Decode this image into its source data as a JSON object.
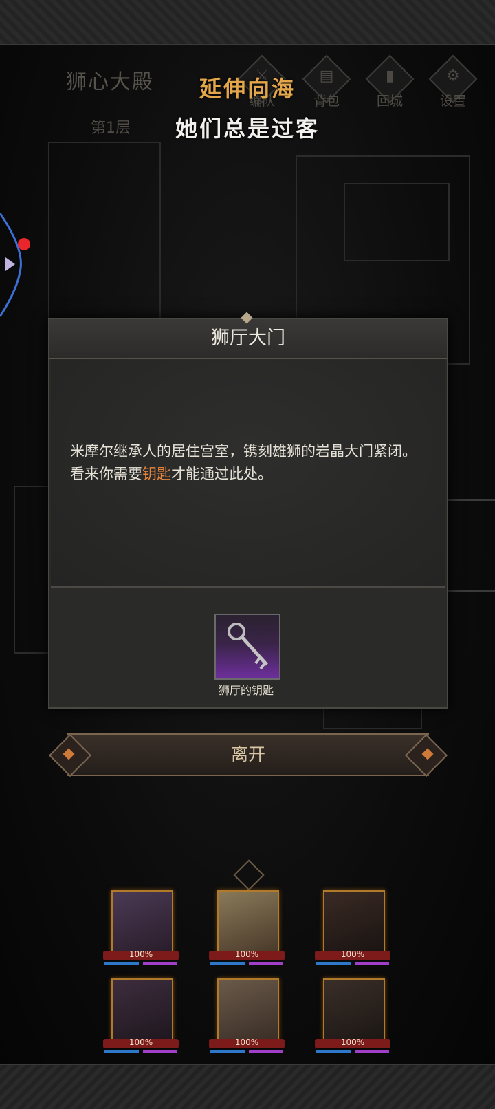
{
  "location": {
    "name": "狮心大殿",
    "floor": "第1层"
  },
  "nav": [
    {
      "label": "编队",
      "icon": "team-icon"
    },
    {
      "label": "背包",
      "icon": "backpack-icon"
    },
    {
      "label": "回城",
      "icon": "return-town-icon"
    },
    {
      "label": "设置",
      "icon": "gear-icon"
    }
  ],
  "overlay": {
    "line1": "延伸向海",
    "line2": "她们总是过客"
  },
  "dialog": {
    "title": "狮厅大门",
    "text_before": "米摩尔继承人的居住宫室，镌刻雄狮的岩晶大门紧闭。看来你需要",
    "text_highlight": "钥匙",
    "text_after": "才能通过此处。",
    "item_name": "狮厅的钥匙",
    "leave_label": "离开"
  },
  "party": [
    {
      "hp": "100%"
    },
    {
      "hp": "100%"
    },
    {
      "hp": "100%"
    },
    {
      "hp": "100%"
    },
    {
      "hp": "100%"
    },
    {
      "hp": "100%"
    }
  ],
  "colors": {
    "highlight": "#e7843c",
    "overlay_gold": "#e3a64a",
    "hp_red": "#7d1b1b",
    "rarity_purple": "#6d2f9c"
  }
}
